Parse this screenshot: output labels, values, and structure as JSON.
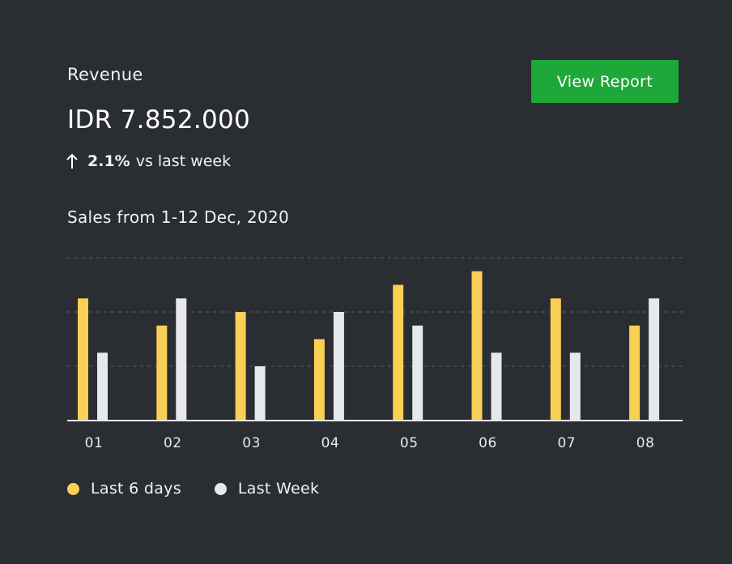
{
  "header": {
    "title": "Revenue",
    "amount": "IDR 7.852.000",
    "change_percent": "2.1%",
    "change_text": "vs last week",
    "change_direction": "up",
    "view_report_label": "View Report"
  },
  "colors": {
    "background": "#2a2d31",
    "accent_button": "#1fa83a",
    "series_current": "#f9cf54",
    "series_previous": "#e7e8ea",
    "gridline": "#5a5d62",
    "axis": "#e8e8e8"
  },
  "chart_data": {
    "type": "bar",
    "title": "Sales from 1-12 Dec, 2020",
    "categories": [
      "01",
      "02",
      "03",
      "04",
      "05",
      "06",
      "07",
      "08"
    ],
    "series": [
      {
        "name": "Last 6 days",
        "values": [
          9,
          7,
          8,
          6,
          10,
          11,
          9,
          7
        ]
      },
      {
        "name": "Last Week",
        "values": [
          5,
          9,
          4,
          8,
          7,
          5,
          5,
          9
        ]
      }
    ],
    "ylim": [
      0,
      12
    ],
    "gridlines": [
      4,
      8,
      12
    ],
    "grid": true,
    "legend_position": "bottom-left"
  }
}
